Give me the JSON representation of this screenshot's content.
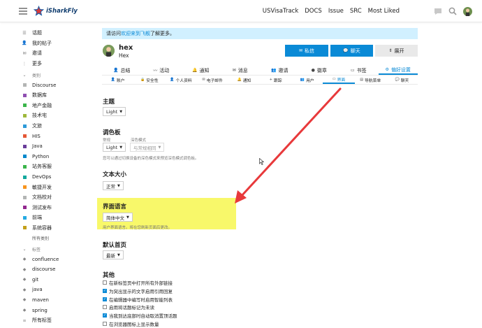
{
  "header": {
    "logo_text": "iSharkFly",
    "nav": [
      "USVisaTrack",
      "DOCS",
      "Issue",
      "SRC",
      "Most Liked"
    ]
  },
  "sidebar": {
    "items": [
      {
        "icon": "topics-icon",
        "label": "话题"
      },
      {
        "icon": "my-posts-icon",
        "label": "我的帖子"
      },
      {
        "icon": "invite-icon",
        "label": "邀请"
      },
      {
        "icon": "more-icon",
        "label": "更多"
      }
    ],
    "categories_heading": "类别",
    "categories": [
      {
        "label": "Discourse",
        "color": "#b3b5b4"
      },
      {
        "label": "数据库",
        "color": "#8f4fb1"
      },
      {
        "label": "地产金融",
        "color": "#3ab54a"
      },
      {
        "label": "技术宅",
        "color": "#9eb83b"
      },
      {
        "label": "文旅",
        "color": "#2d9ad8"
      },
      {
        "label": "HIS",
        "color": "#e45735"
      },
      {
        "label": "Java",
        "color": "#6a3d9a"
      },
      {
        "label": "Python",
        "color": "#0088cc"
      },
      {
        "label": "站务客服",
        "color": "#3ab54a"
      },
      {
        "label": "DevOps",
        "color": "#12a89d"
      },
      {
        "label": "敏捷开发",
        "color": "#f7941d"
      },
      {
        "label": "文档校对",
        "color": "#b3b5b4"
      },
      {
        "label": "测试发布",
        "color": "#92278f"
      },
      {
        "label": "前端",
        "color": "#25aae2"
      },
      {
        "label": "系统容器",
        "color": "#c4a01a"
      }
    ],
    "all_categories": "所有类别",
    "tags_heading": "标签",
    "tags": [
      "confluence",
      "discourse",
      "git",
      "java",
      "maven",
      "spring"
    ],
    "all_tags": "所有标签"
  },
  "banner": {
    "prefix": "请访问",
    "link": "欢迎来到飞舰",
    "suffix": "了解更多。"
  },
  "profile": {
    "username": "hex",
    "name": "Hex",
    "message_label": "私信",
    "chat_label": "聊天",
    "expand_label": "展开"
  },
  "tabs_primary": [
    {
      "icon": "summary-icon",
      "label": "总结"
    },
    {
      "icon": "activity-icon",
      "label": "活动"
    },
    {
      "icon": "bell-icon",
      "label": "通知"
    },
    {
      "icon": "envelope-icon",
      "label": "消息"
    },
    {
      "icon": "invite-icon",
      "label": "邀请"
    },
    {
      "icon": "badge-icon",
      "label": "徽章"
    },
    {
      "icon": "bookmark-icon",
      "label": "书签"
    },
    {
      "icon": "gear-icon",
      "label": "偏好设置"
    }
  ],
  "tabs_secondary": [
    {
      "icon": "user-icon",
      "label": "账户"
    },
    {
      "icon": "lock-icon",
      "label": "安全性"
    },
    {
      "icon": "user-icon",
      "label": "个人资料"
    },
    {
      "icon": "envelope-icon",
      "label": "电子邮件"
    },
    {
      "icon": "bell-icon",
      "label": "通知"
    },
    {
      "icon": "plus-icon",
      "label": "跟踪"
    },
    {
      "icon": "users-icon",
      "label": "用户"
    },
    {
      "icon": "desktop-icon",
      "label": "界面"
    },
    {
      "icon": "sidebar-icon",
      "label": "导航菜单"
    },
    {
      "icon": "comment-icon",
      "label": "聊天"
    }
  ],
  "settings": {
    "theme": {
      "title": "主题",
      "value": "Light"
    },
    "palette": {
      "title": "调色板",
      "regular_label": "常规",
      "regular_value": "Light",
      "dark_label": "深色模式",
      "dark_value": "与常规相同",
      "hint": "您可以通过切换设备的深色模式来预览深色模式调色板。"
    },
    "text_size": {
      "title": "文本大小",
      "value": "正常"
    },
    "language": {
      "title": "界面语言",
      "value": "简体中文",
      "hint": "用户界面语言。将在您刷新页面后更改。"
    },
    "homepage": {
      "title": "默认首页",
      "value": "最新"
    },
    "other": {
      "title": "其他",
      "options": [
        {
          "label": "在新标签页中打开所有外部链接",
          "checked": false
        },
        {
          "label": "为突出显示的文字启用引用回复",
          "checked": true
        },
        {
          "label": "在编辑器中编写时启用智能列表",
          "checked": true
        },
        {
          "label": "启用将话题标记为未读",
          "checked": false
        },
        {
          "label": "当我到达底部时自动取消置顶话题",
          "checked": true
        },
        {
          "label": "在浏览器图标上显示数量",
          "checked": false
        }
      ]
    }
  },
  "colors": {
    "accent": "#0a8ad6",
    "highlight": "#f7f75a",
    "arrow": "#e8393b"
  }
}
